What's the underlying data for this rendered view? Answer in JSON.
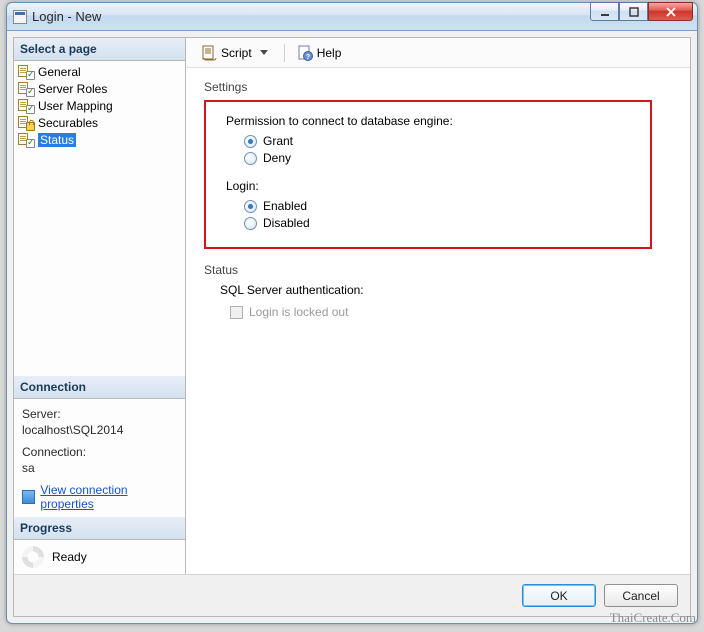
{
  "window": {
    "title": "Login - New"
  },
  "sidebar": {
    "select_page": "Select a page",
    "items": [
      {
        "label": "General"
      },
      {
        "label": "Server Roles"
      },
      {
        "label": "User Mapping"
      },
      {
        "label": "Securables"
      },
      {
        "label": "Status"
      }
    ],
    "selected_index": 4
  },
  "connection": {
    "heading": "Connection",
    "server_label": "Server:",
    "server_value": "localhost\\SQL2014",
    "connection_label": "Connection:",
    "connection_value": "sa",
    "view_props": "View connection properties"
  },
  "progress": {
    "heading": "Progress",
    "status": "Ready"
  },
  "toolbar": {
    "script": "Script",
    "help": "Help"
  },
  "settings": {
    "heading": "Settings",
    "perm_label": "Permission to connect to database engine:",
    "grant": "Grant",
    "deny": "Deny",
    "login_label": "Login:",
    "enabled": "Enabled",
    "disabled": "Disabled",
    "selected_perm": "grant",
    "selected_login": "enabled"
  },
  "status_group": {
    "heading": "Status",
    "auth_label": "SQL Server authentication:",
    "locked_out": "Login is locked out"
  },
  "buttons": {
    "ok": "OK",
    "cancel": "Cancel"
  },
  "watermark": "ThaiCreate.Com"
}
